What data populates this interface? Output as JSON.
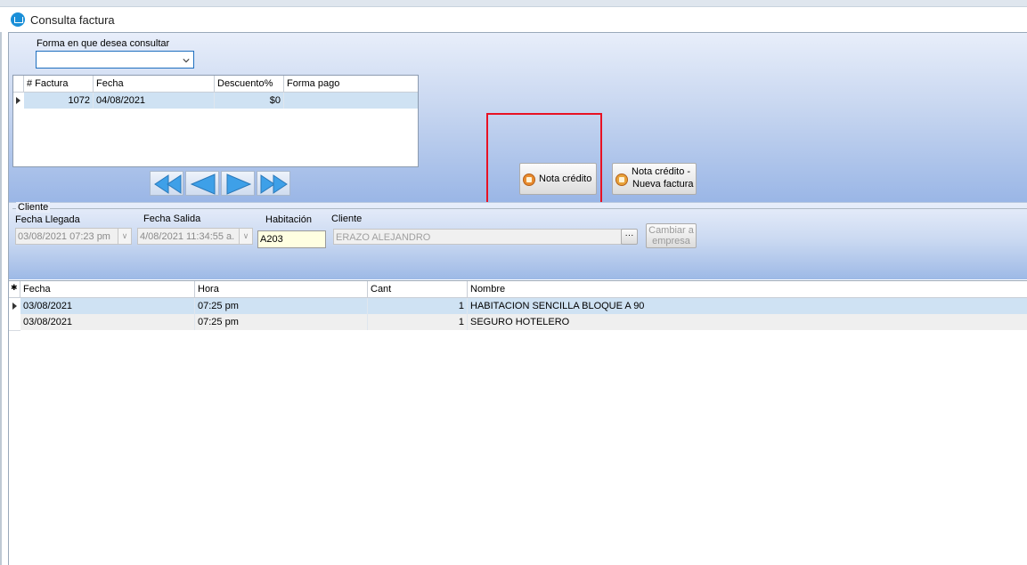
{
  "window": {
    "title": "Consulta factura"
  },
  "query": {
    "label": "Forma en que desea consultar",
    "value": ""
  },
  "invoice_grid": {
    "columns": [
      "# Factura",
      "Fecha",
      "Descuento%",
      "Forma pago"
    ],
    "rows": [
      {
        "factura": "1072",
        "fecha": "04/08/2021",
        "descuento": "$0",
        "forma_pago": ""
      }
    ]
  },
  "nav_buttons": [
    "first-icon",
    "previous-icon",
    "next-icon",
    "last-icon"
  ],
  "actions": {
    "nota_credito": "Nota crédito",
    "nota_credito_nueva_line1": "Nota crédito -",
    "nota_credito_nueva_line2": "Nueva factura"
  },
  "client": {
    "group_label": "Cliente",
    "fecha_llegada_label": "Fecha Llegada",
    "fecha_llegada": "03/08/2021 07:23 pm",
    "fecha_salida_label": "Fecha Salida",
    "fecha_salida": "4/08/2021 11:34:55 a.",
    "habitacion_label": "Habitación",
    "habitacion": "A203",
    "cliente_label": "Cliente",
    "cliente": "ERAZO ALEJANDRO",
    "ellipsis": "···",
    "cambiar_line1": "Cambiar a",
    "cambiar_line2": "empresa"
  },
  "detail_grid": {
    "columns": [
      "Fecha",
      "Hora",
      "Cant",
      "Nombre"
    ],
    "rows": [
      {
        "fecha": "03/08/2021",
        "hora": "07:25 pm",
        "cant": "1",
        "nombre": "HABITACION SENCILLA BLOQUE A 90"
      },
      {
        "fecha": "03/08/2021",
        "hora": "07:25 pm",
        "cant": "1",
        "nombre": "SEGURO HOTELERO"
      }
    ]
  },
  "colors": {
    "highlight": "#e81123",
    "selected_row": "#cfe2f3",
    "panel_gradient_end": "#9ab6e6"
  }
}
